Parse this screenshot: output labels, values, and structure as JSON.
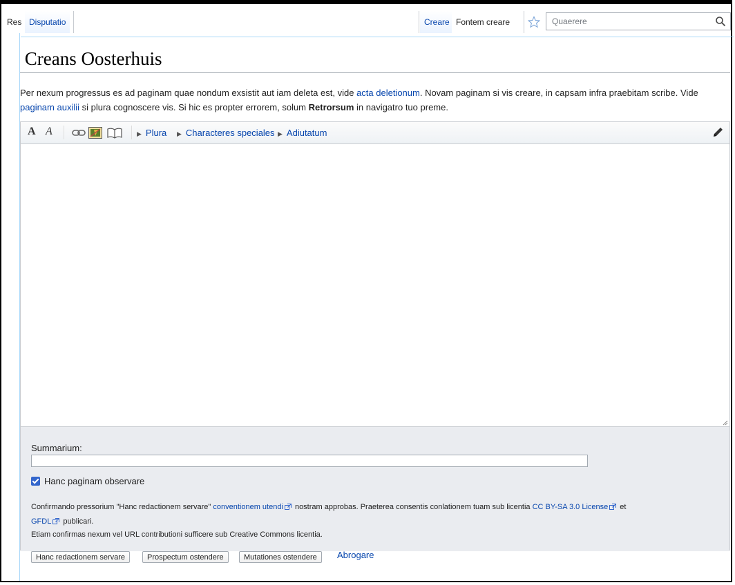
{
  "tabs": {
    "page": "Res",
    "talk": "Disputatio",
    "create": "Creare",
    "create_source": "Fontem creare",
    "search_placeholder": "Quaerere"
  },
  "title": "Creans Oosterhuis",
  "intro": {
    "part1": "Per nexum progressus es ad paginam quae nondum exsistit aut iam deleta est, vide ",
    "link1": "acta deletionum",
    "part2": ". Novam paginam si vis creare, in capsam infra praebitam scribe. Vide ",
    "link2": "paginam auxilii",
    "part3": " si plura cognoscere vis. Si hic es propter errorem, solum ",
    "bold": "Retrorsum",
    "part4": " in navigatro tuo preme."
  },
  "toolbar": {
    "bold": "A",
    "italic": "A",
    "menu_more": "Plura",
    "menu_special": "Characteres speciales",
    "menu_help": "Adiutatum"
  },
  "summary": {
    "label": "Summarium:",
    "value": ""
  },
  "watch": {
    "label": "Hanc paginam observare",
    "checked": true
  },
  "legal": {
    "part1": "Confirmando pressorium \"Hanc redactionem servare\" ",
    "link_terms": "conventionem utendi",
    "part2": " nostram approbas. Praeterea consentis conlationem tuam sub licentia ",
    "link_cc": "CC BY-SA 3.0 License",
    "part3": " et",
    "link_gfdl": "GFDL",
    "part4": " publicari.",
    "line2": "Etiam confirmas nexum vel URL contributioni sufficere sub Creative Commons licentia."
  },
  "buttons": {
    "save": "Hanc redactionem servare",
    "preview": "Prospectum ostendere",
    "diff": "Mutationes ostendere",
    "cancel": "Abrogare"
  },
  "colors": {
    "link": "#0645ad",
    "accent": "#3366cc"
  }
}
